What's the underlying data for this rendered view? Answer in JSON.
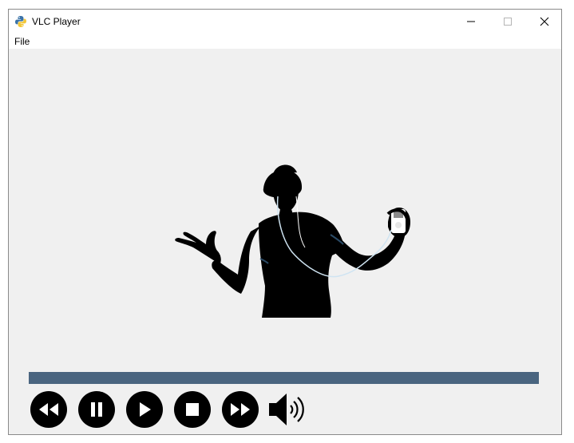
{
  "window": {
    "title": "VLC Player",
    "app_icon": "python-icon",
    "controls": [
      "minimize-icon",
      "maximize-icon",
      "close-icon"
    ]
  },
  "menu": {
    "items": [
      {
        "label": "File"
      }
    ]
  },
  "video": {
    "artwork": "dancing-silhouette-with-music-player"
  },
  "playback": {
    "progress_fraction": 1.0,
    "progress_color": "#4a6580",
    "buttons": [
      "rewind-icon",
      "pause-icon",
      "play-icon",
      "stop-icon",
      "fast-forward-icon",
      "volume-icon"
    ]
  }
}
